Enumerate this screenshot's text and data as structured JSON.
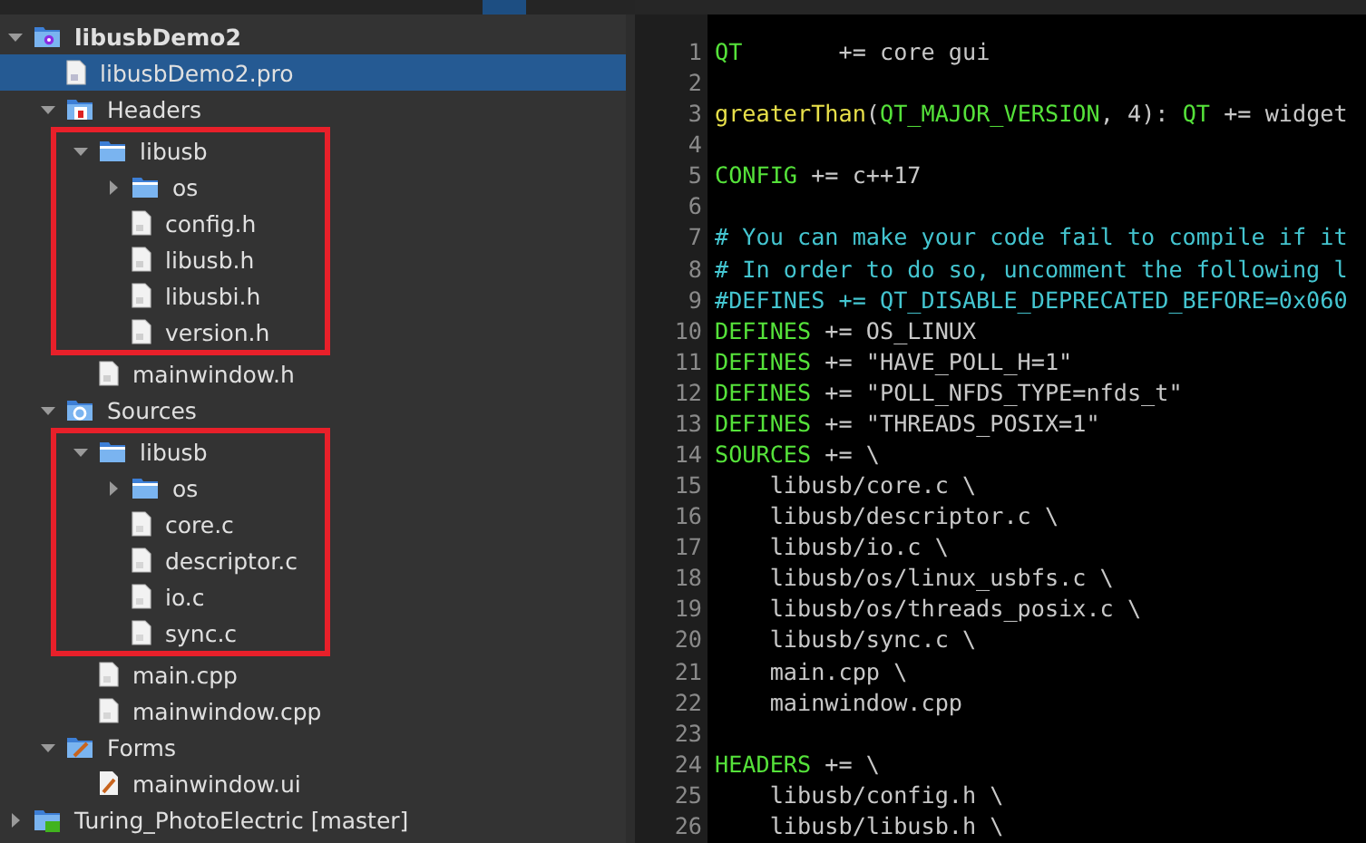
{
  "project_tree": [
    {
      "label": "libusbDemo2",
      "kind": "project",
      "expanded": true,
      "selected": false,
      "children": [
        {
          "label": "libusbDemo2.pro",
          "kind": "pro",
          "selected": true
        },
        {
          "label": "Headers",
          "kind": "headers",
          "expanded": true,
          "selected": false,
          "children": [
            {
              "label": "libusb",
              "kind": "folder",
              "expanded": true,
              "highlighted": true,
              "selected": false,
              "children": [
                {
                  "label": "os",
                  "kind": "folder",
                  "expanded": false,
                  "selected": false
                },
                {
                  "label": "config.h",
                  "kind": "header",
                  "selected": false
                },
                {
                  "label": "libusb.h",
                  "kind": "header",
                  "selected": false
                },
                {
                  "label": "libusbi.h",
                  "kind": "header",
                  "selected": false
                },
                {
                  "label": "version.h",
                  "kind": "header",
                  "selected": false
                }
              ]
            },
            {
              "label": "mainwindow.h",
              "kind": "header",
              "selected": false
            }
          ]
        },
        {
          "label": "Sources",
          "kind": "sources",
          "expanded": true,
          "selected": false,
          "children": [
            {
              "label": "libusb",
              "kind": "folder",
              "expanded": true,
              "highlighted": true,
              "selected": false,
              "children": [
                {
                  "label": "os",
                  "kind": "folder",
                  "expanded": false,
                  "selected": false
                },
                {
                  "label": "core.c",
                  "kind": "source",
                  "selected": false
                },
                {
                  "label": "descriptor.c",
                  "kind": "source",
                  "selected": false
                },
                {
                  "label": "io.c",
                  "kind": "source",
                  "selected": false
                },
                {
                  "label": "sync.c",
                  "kind": "source",
                  "selected": false
                }
              ]
            },
            {
              "label": "main.cpp",
              "kind": "source",
              "selected": false
            },
            {
              "label": "mainwindow.cpp",
              "kind": "source",
              "selected": false
            }
          ]
        },
        {
          "label": "Forms",
          "kind": "forms",
          "expanded": true,
          "selected": false,
          "children": [
            {
              "label": "mainwindow.ui",
              "kind": "form",
              "selected": false
            }
          ]
        }
      ]
    },
    {
      "label": "Turing_PhotoElectric [master]",
      "kind": "repository",
      "expanded": false,
      "selected": false
    }
  ],
  "editor": {
    "lines": [
      {
        "number": "1",
        "segments": [
          {
            "kind": "keyword",
            "text": "QT"
          },
          {
            "kind": "plain",
            "text": "       += core gui"
          }
        ]
      },
      {
        "number": "2"
      },
      {
        "number": "3",
        "segments": [
          {
            "kind": "function",
            "text": "greaterThan"
          },
          {
            "kind": "plain",
            "text": "("
          },
          {
            "kind": "keyword",
            "text": "QT_MAJOR_VERSION"
          },
          {
            "kind": "plain",
            "text": ", 4): "
          },
          {
            "kind": "keyword",
            "text": "QT"
          },
          {
            "kind": "plain",
            "text": " += widget"
          }
        ]
      },
      {
        "number": "4"
      },
      {
        "number": "5",
        "segments": [
          {
            "kind": "keyword",
            "text": "CONFIG"
          },
          {
            "kind": "plain",
            "text": " += c++17"
          }
        ]
      },
      {
        "number": "6"
      },
      {
        "number": "7",
        "segments": [
          {
            "kind": "comment",
            "text": "# You can make your code fail to compile if it"
          }
        ]
      },
      {
        "number": "8",
        "segments": [
          {
            "kind": "comment",
            "text": "# In order to do so, uncomment the following l"
          }
        ]
      },
      {
        "number": "9",
        "segments": [
          {
            "kind": "comment",
            "text": "#DEFINES += QT_DISABLE_DEPRECATED_BEFORE=0x060"
          }
        ]
      },
      {
        "number": "10",
        "segments": [
          {
            "kind": "keyword",
            "text": "DEFINES"
          },
          {
            "kind": "plain",
            "text": " += OS_LINUX"
          }
        ]
      },
      {
        "number": "11",
        "segments": [
          {
            "kind": "keyword",
            "text": "DEFINES"
          },
          {
            "kind": "plain",
            "text": " += \"HAVE_POLL_H=1\""
          }
        ]
      },
      {
        "number": "12",
        "segments": [
          {
            "kind": "keyword",
            "text": "DEFINES"
          },
          {
            "kind": "plain",
            "text": " += \"POLL_NFDS_TYPE=nfds_t\""
          }
        ]
      },
      {
        "number": "13",
        "segments": [
          {
            "kind": "keyword",
            "text": "DEFINES"
          },
          {
            "kind": "plain",
            "text": " += \"THREADS_POSIX=1\""
          }
        ]
      },
      {
        "number": "14",
        "segments": [
          {
            "kind": "keyword",
            "text": "SOURCES"
          },
          {
            "kind": "plain",
            "text": " += \\"
          }
        ]
      },
      {
        "number": "15",
        "segments": [
          {
            "kind": "plain",
            "text": "    libusb/core.c \\"
          }
        ]
      },
      {
        "number": "16",
        "segments": [
          {
            "kind": "plain",
            "text": "    libusb/descriptor.c \\"
          }
        ]
      },
      {
        "number": "17",
        "segments": [
          {
            "kind": "plain",
            "text": "    libusb/io.c \\"
          }
        ]
      },
      {
        "number": "18",
        "segments": [
          {
            "kind": "plain",
            "text": "    libusb/os/linux_usbfs.c \\"
          }
        ]
      },
      {
        "number": "19",
        "segments": [
          {
            "kind": "plain",
            "text": "    libusb/os/threads_posix.c \\"
          }
        ]
      },
      {
        "number": "20",
        "segments": [
          {
            "kind": "plain",
            "text": "    libusb/sync.c \\"
          }
        ]
      },
      {
        "number": "21",
        "segments": [
          {
            "kind": "plain",
            "text": "    main.cpp \\"
          }
        ]
      },
      {
        "number": "22",
        "segments": [
          {
            "kind": "plain",
            "text": "    mainwindow.cpp"
          }
        ]
      },
      {
        "number": "23"
      },
      {
        "number": "24",
        "segments": [
          {
            "kind": "keyword",
            "text": "HEADERS"
          },
          {
            "kind": "plain",
            "text": " += \\"
          }
        ]
      },
      {
        "number": "25",
        "segments": [
          {
            "kind": "plain",
            "text": "    libusb/config.h \\"
          }
        ]
      },
      {
        "number": "26",
        "segments": [
          {
            "kind": "plain",
            "text": "    libusb/libusb.h \\"
          }
        ]
      }
    ]
  }
}
